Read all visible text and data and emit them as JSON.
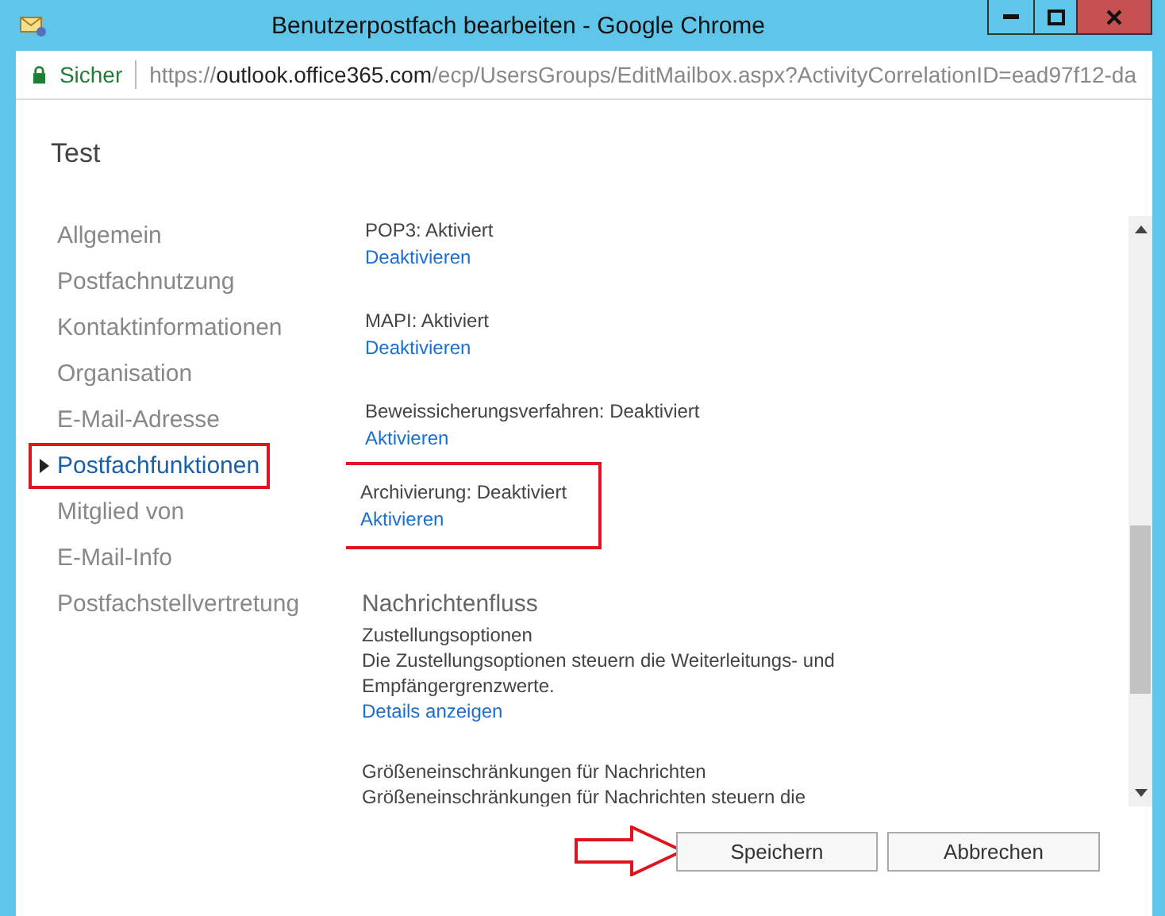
{
  "window": {
    "title": "Benutzerpostfach bearbeiten - Google Chrome"
  },
  "address_bar": {
    "security": "Sicher",
    "url_scheme": "https://",
    "url_host": "outlook.office365.com",
    "url_path": "/ecp/UsersGroups/EditMailbox.aspx?ActivityCorrelationID=ead97f12-da"
  },
  "page_title": "Test",
  "nav": [
    {
      "label": "Allgemein",
      "selected": false,
      "annotated": false
    },
    {
      "label": "Postfachnutzung",
      "selected": false,
      "annotated": false
    },
    {
      "label": "Kontaktinformationen",
      "selected": false,
      "annotated": false
    },
    {
      "label": "Organisation",
      "selected": false,
      "annotated": false
    },
    {
      "label": "E-Mail-Adresse",
      "selected": false,
      "annotated": false
    },
    {
      "label": "Postfachfunktionen",
      "selected": true,
      "annotated": true
    },
    {
      "label": "Mitglied von",
      "selected": false,
      "annotated": false
    },
    {
      "label": "E-Mail-Info",
      "selected": false,
      "annotated": false
    },
    {
      "label": "Postfachstellvertretung",
      "selected": false,
      "annotated": false
    }
  ],
  "sections": [
    {
      "kind": "status",
      "label": "POP3: Aktiviert",
      "action": "Deaktivieren",
      "annotated": false
    },
    {
      "kind": "status",
      "label": "MAPI: Aktiviert",
      "action": "Deaktivieren",
      "annotated": false
    },
    {
      "kind": "status",
      "label": "Beweissicherungsverfahren: Deaktiviert",
      "action": "Aktivieren",
      "annotated": false
    },
    {
      "kind": "status",
      "label": "Archivierung: Deaktiviert",
      "action": "Aktivieren",
      "annotated": true
    },
    {
      "kind": "heading",
      "label": "Nachrichtenfluss"
    },
    {
      "kind": "option",
      "label": "Zustellungsoptionen",
      "description": "Die Zustellungsoptionen steuern die Weiterleitungs- und Empfängergrenzwerte.",
      "action": "Details anzeigen"
    },
    {
      "kind": "option",
      "label": "Größeneinschränkungen für Nachrichten",
      "description": "Größeneinschränkungen für Nachrichten steuern die"
    }
  ],
  "buttons": [
    {
      "label": "Speichern",
      "annotated": true
    },
    {
      "label": "Abbrechen",
      "annotated": false
    }
  ]
}
